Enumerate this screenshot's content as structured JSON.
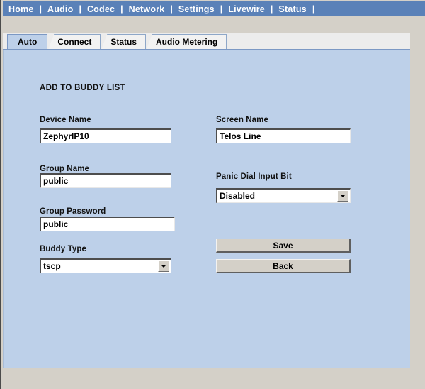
{
  "nav": {
    "separator": "|",
    "items": [
      {
        "label": "Home",
        "name": "nav-home"
      },
      {
        "label": "Audio",
        "name": "nav-audio"
      },
      {
        "label": "Codec",
        "name": "nav-codec"
      },
      {
        "label": "Network",
        "name": "nav-network"
      },
      {
        "label": "Settings",
        "name": "nav-settings"
      },
      {
        "label": "Livewire",
        "name": "nav-livewire"
      },
      {
        "label": "Status",
        "name": "nav-status"
      }
    ]
  },
  "tabs": [
    {
      "label": "Auto",
      "active": true
    },
    {
      "label": "Connect",
      "active": false
    },
    {
      "label": "Status",
      "active": false
    },
    {
      "label": "Audio Metering",
      "active": false
    }
  ],
  "form": {
    "title": "ADD TO BUDDY LIST",
    "device_name": {
      "label": "Device Name",
      "value": "ZephyrIP10",
      "placeholder": ""
    },
    "screen_name": {
      "label": "Screen Name",
      "value": "Telos Line",
      "placeholder": ""
    },
    "group_name": {
      "label": "Group Name",
      "value": "public",
      "placeholder": ""
    },
    "group_password": {
      "label": "Group Password",
      "value": "public",
      "placeholder": ""
    },
    "panic_dial_input_bit": {
      "label": "Panic Dial Input Bit",
      "value": "Disabled",
      "options": [
        "Disabled"
      ]
    },
    "buddy_type": {
      "label": "Buddy Type",
      "value": "tscp",
      "options": [
        "tscp"
      ]
    },
    "save_button": "Save",
    "back_button": "Back"
  },
  "colors": {
    "navbar": "#5a81b8",
    "panel": "#bdd0e9",
    "chrome": "#d4d0c8",
    "tab_active": "#bdd0e9",
    "tab_inactive": "#f2f2f2"
  }
}
